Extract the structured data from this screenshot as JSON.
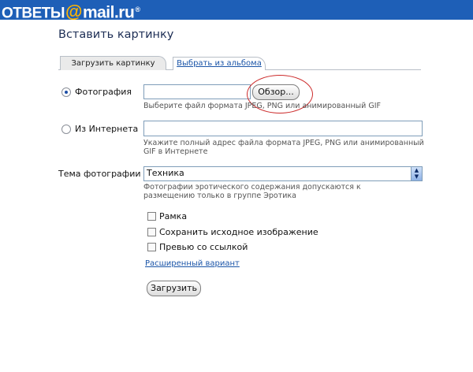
{
  "header": {
    "logo_left": "ОТВЕТЫ",
    "logo_at": "@",
    "logo_right": "mail.ru",
    "logo_mark": "®",
    "bar_color": "#1e5fb7",
    "at_color": "#ffb400"
  },
  "page": {
    "title": "Вставить картинку"
  },
  "tabs": [
    {
      "label": "Загрузить картинку",
      "active": true
    },
    {
      "label": "Выбрать из альбома",
      "active": false
    }
  ],
  "source": {
    "photo": {
      "label": "Фотография",
      "selected": true,
      "value": "",
      "browse_label": "Обзор...",
      "hint": "Выберите файл формата JPEG, PNG или анимированный GIF"
    },
    "internet": {
      "label": "Из Интернета",
      "selected": false,
      "value": "",
      "hint": "Укажите полный адрес файла формата JPEG, PNG или анимированный GIF в Интернете"
    }
  },
  "topic": {
    "label": "Тема фотографии",
    "selected": "Техника",
    "hint": "Фотографии эротического содержания допускаются к размещению только в группе Эротика"
  },
  "options": [
    {
      "label": "Рамка",
      "checked": false
    },
    {
      "label": "Сохранить исходное изображение",
      "checked": false
    },
    {
      "label": "Превью со ссылкой",
      "checked": false
    }
  ],
  "advanced_link": "Расширенный вариант",
  "submit_label": "Загрузить",
  "annotation_color": "#cc2a2a"
}
